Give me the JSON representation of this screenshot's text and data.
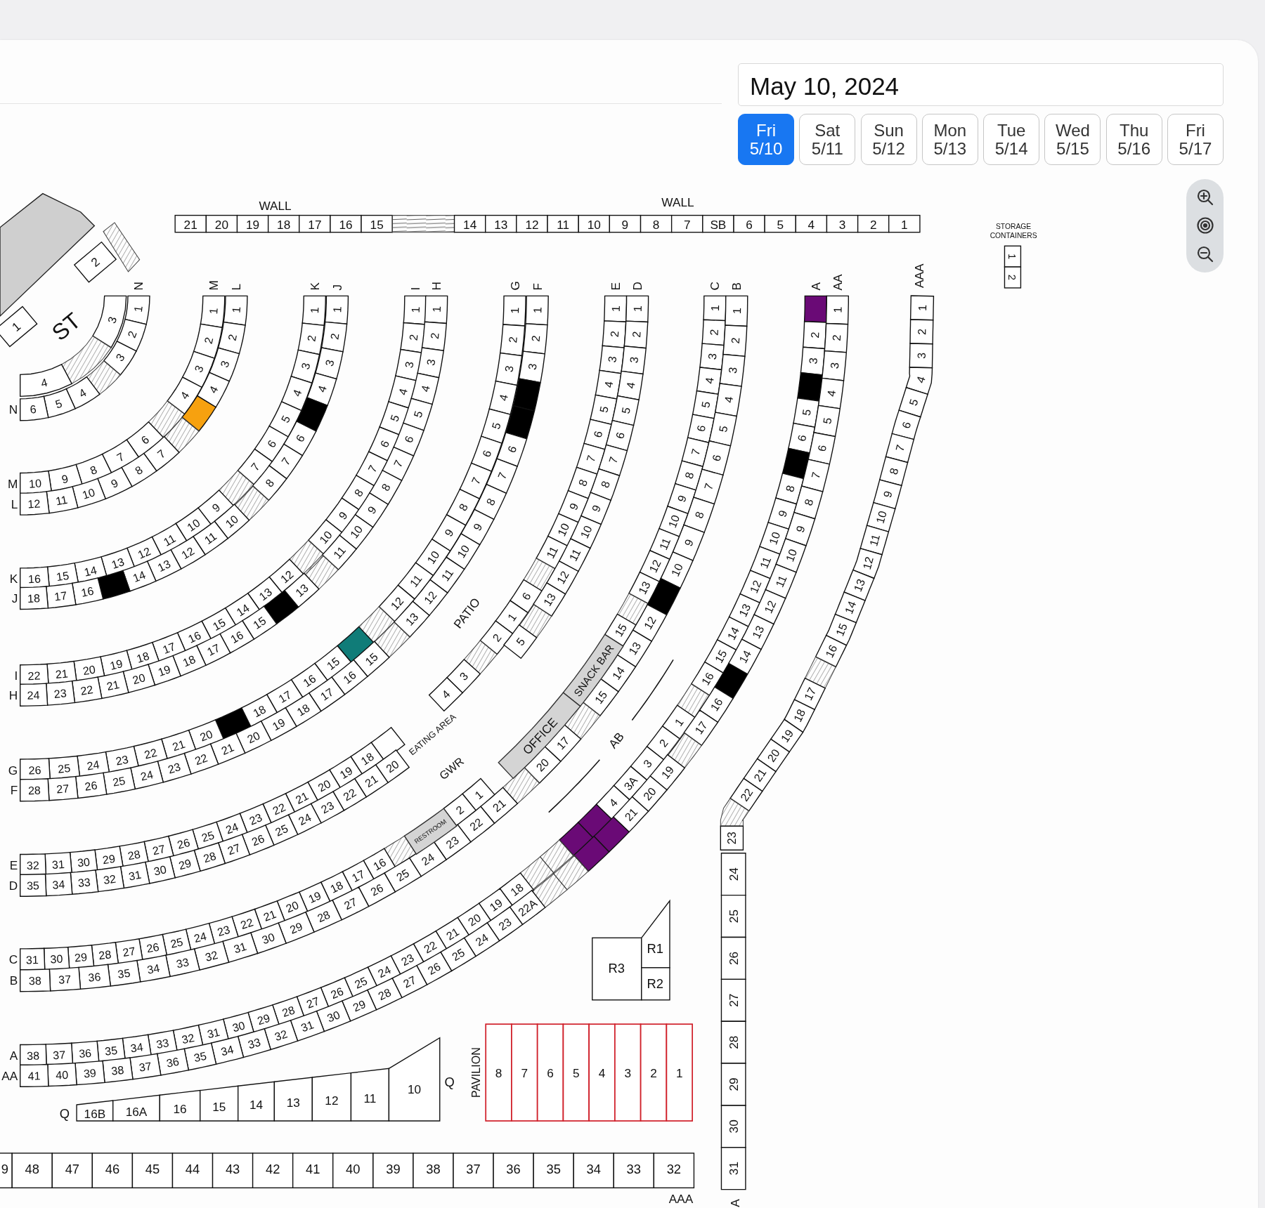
{
  "date_field": {
    "value": "May 10, 2024"
  },
  "day_tabs": [
    {
      "day": "Fri",
      "date": "5/10",
      "selected": true
    },
    {
      "day": "Sat",
      "date": "5/11",
      "selected": false
    },
    {
      "day": "Sun",
      "date": "5/12",
      "selected": false
    },
    {
      "day": "Mon",
      "date": "5/13",
      "selected": false
    },
    {
      "day": "Tue",
      "date": "5/14",
      "selected": false
    },
    {
      "day": "Wed",
      "date": "5/15",
      "selected": false
    },
    {
      "day": "Thu",
      "date": "5/16",
      "selected": false
    },
    {
      "day": "Fri",
      "date": "5/17",
      "selected": false
    }
  ],
  "map": {
    "wall": {
      "labels": [
        "WALL",
        "WALL"
      ],
      "seats": [
        "21",
        "20",
        "19",
        "18",
        "17",
        "16",
        "15",
        {
          "kind": "aisle"
        },
        "14",
        "13",
        "12",
        "11",
        "10",
        "9",
        "8",
        "7",
        "SB",
        "6",
        "5",
        "4",
        "3",
        "2",
        "1"
      ]
    },
    "stage": {
      "label": "ST",
      "boxes": [
        "1",
        "2"
      ]
    },
    "storage": {
      "label_lines": [
        "STORAGE",
        "CONTAINERS"
      ],
      "boxes": [
        "1",
        "2"
      ]
    },
    "rings": [
      {
        "rows": [
          {
            "seats": [
              "3",
              {
                "kind": "aisle"
              },
              "4"
            ]
          },
          {
            "top_label": "N",
            "side_label": "N",
            "seats": [
              "1",
              "2",
              "3",
              {
                "kind": "aisle"
              },
              "4",
              "5",
              "6"
            ]
          }
        ]
      },
      {
        "rows": [
          {
            "top_label": "M",
            "side_label": "M",
            "seats": [
              "1",
              "2",
              "3",
              "4",
              {
                "kind": "aisle"
              },
              "6",
              "7",
              "8",
              "9",
              "10"
            ]
          },
          {
            "top_label": "L",
            "side_label": "L",
            "seats": [
              "1",
              "2",
              "3",
              "4",
              {
                "kind": "filled",
                "color": "#f7a10f"
              },
              {
                "kind": "aisle"
              },
              "7",
              "8",
              "9",
              "10",
              "11",
              "12"
            ]
          }
        ]
      },
      {
        "rows": [
          {
            "top_label": "K",
            "side_label": "K",
            "seats": [
              "1",
              "2",
              "3",
              "4",
              "5",
              "6",
              "7",
              {
                "kind": "aisle"
              },
              "9",
              "10",
              "11",
              "12",
              "13",
              "14",
              "15",
              "16"
            ]
          },
          {
            "top_label": "J",
            "side_label": "J",
            "seats": [
              "1",
              "2",
              "3",
              "4",
              {
                "kind": "filled",
                "color": "#000000"
              },
              "6",
              "7",
              "8",
              {
                "kind": "aisle"
              },
              "10",
              "11",
              "12",
              "13",
              "14",
              {
                "kind": "filled",
                "color": "#000000"
              },
              "16",
              "17",
              "18"
            ]
          }
        ]
      },
      {
        "rows": [
          {
            "top_label": "I",
            "side_label": "I",
            "seats": [
              "1",
              "2",
              "3",
              "4",
              "5",
              "6",
              "7",
              "8",
              "9",
              "10",
              {
                "kind": "aisle"
              },
              "12",
              "13",
              "14",
              "15",
              "16",
              "17",
              "18",
              "19",
              "20",
              "21",
              "22"
            ]
          },
          {
            "top_label": "H",
            "side_label": "H",
            "seats": [
              "1",
              "2",
              "3",
              "4",
              "5",
              "6",
              "7",
              "8",
              "9",
              "10",
              "11",
              {
                "kind": "aisle"
              },
              "13",
              {
                "kind": "filled",
                "color": "#000000"
              },
              "15",
              "16",
              "17",
              "18",
              "19",
              "20",
              "21",
              "22",
              "23",
              "24"
            ]
          }
        ]
      },
      {
        "rows": [
          {
            "top_label": "G",
            "side_label": "G",
            "seats": [
              "1",
              "2",
              "3",
              "4",
              "5",
              "6",
              "7",
              "8",
              "9",
              "10",
              "11",
              "12",
              {
                "kind": "aisle"
              },
              {
                "kind": "filled",
                "color": "#107c78"
              },
              "15",
              "16",
              "17",
              "18",
              {
                "kind": "filled",
                "color": "#000000"
              },
              "20",
              "21",
              "22",
              "23",
              "24",
              "25",
              "26"
            ]
          },
          {
            "top_label": "F",
            "side_label": "F",
            "seats": [
              "1",
              "2",
              "3",
              {
                "kind": "filled",
                "color": "#000000"
              },
              {
                "kind": "filled",
                "color": "#000000"
              },
              "6",
              "7",
              "8",
              "9",
              "10",
              "11",
              "12",
              "13",
              {
                "kind": "aisle"
              },
              "15",
              "16",
              "17",
              "18",
              "19",
              "20",
              "21",
              "22",
              "23",
              "24",
              "25",
              "26",
              "27",
              "28"
            ]
          }
        ]
      },
      {
        "rows": [
          {
            "top_label": "E",
            "side_label": "E",
            "seats": [
              "1",
              "2",
              "3",
              "4",
              "5",
              "6",
              "7",
              "8",
              "9",
              "10",
              "11",
              {
                "kind": "aisle"
              },
              "6",
              "1",
              "2",
              {
                "kind": "aisle"
              },
              "3",
              "4",
              {
                "kind": "gap"
              },
              {
                "kind": "gap"
              },
              {
                "kind": "empty"
              },
              "18",
              "19",
              "20",
              "21",
              "22",
              "23",
              "24",
              "25",
              "26",
              "27",
              "28",
              "29",
              "30",
              "31",
              "32"
            ]
          },
          {
            "top_label": "D",
            "side_label": "D",
            "seats": [
              "1",
              "2",
              "3",
              "4",
              "5",
              "6",
              "7",
              "8",
              "9",
              "10",
              "11",
              "12",
              "13",
              {
                "kind": "aisle"
              },
              "5",
              {
                "kind": "gap"
              },
              {
                "kind": "gap"
              },
              {
                "kind": "gap"
              },
              {
                "kind": "gap"
              },
              {
                "kind": "gap"
              },
              {
                "kind": "gap"
              },
              "20",
              "21",
              "22",
              "23",
              "24",
              "25",
              "26",
              "27",
              "28",
              "29",
              "30",
              "31",
              "32",
              "33",
              "34",
              "35"
            ]
          }
        ]
      },
      {
        "rows": [
          {
            "top_label": "C",
            "side_label": "C",
            "seats": [
              "1",
              "2",
              "3",
              "4",
              "5",
              "6",
              "7",
              "8",
              "9",
              "10",
              "11",
              "12",
              "13",
              {
                "kind": "aisle"
              },
              "15",
              {
                "kind": "gap"
              },
              {
                "kind": "gap"
              },
              {
                "kind": "gap"
              },
              {
                "kind": "gap"
              },
              {
                "kind": "gap"
              },
              {
                "kind": "gap"
              },
              {
                "kind": "gap"
              },
              {
                "kind": "gap"
              },
              "1",
              "2",
              {
                "kind": "gap"
              },
              {
                "kind": "gap"
              },
              {
                "kind": "aisle"
              },
              "16",
              "17",
              "18",
              "19",
              "20",
              "21",
              "22",
              "23",
              "24",
              "25",
              "26",
              "27",
              "28",
              "29",
              "30",
              "31"
            ]
          },
          {
            "top_label": "B",
            "side_label": "B",
            "seats": [
              "1",
              "2",
              "3",
              "4",
              "5",
              "6",
              "7",
              "8",
              "9",
              "10",
              {
                "kind": "filled",
                "color": "#000000"
              },
              "12",
              "13",
              "14",
              "15",
              {
                "kind": "aisle"
              },
              "17",
              "20",
              {
                "kind": "aisle"
              },
              "21",
              "22",
              "23",
              "24",
              "25",
              "26",
              "27",
              "28",
              "29",
              "30",
              "31",
              "32",
              "33",
              "34",
              "35",
              "36",
              "37",
              "38"
            ]
          }
        ]
      },
      {
        "rows": [
          {
            "top_label": "A",
            "side_label": "A",
            "seats": [
              {
                "kind": "filled",
                "color": "#6a0a76"
              },
              "2",
              "3",
              {
                "kind": "filled",
                "color": "#000000"
              },
              "5",
              "6",
              {
                "kind": "filled",
                "color": "#000000"
              },
              "8",
              "9",
              "10",
              "11",
              "12",
              "13",
              "14",
              "15",
              "16",
              {
                "kind": "aisle"
              },
              "1",
              "2",
              "3",
              "3A",
              "4",
              {
                "kind": "filled",
                "color": "#6a0a76"
              },
              {
                "kind": "filled",
                "color": "#6a0a76"
              },
              {
                "kind": "aisle"
              },
              {
                "kind": "aisle"
              },
              "18",
              "19",
              "20",
              "21",
              "22",
              "23",
              "24",
              "25",
              "26",
              "27",
              "28",
              "29",
              "30",
              "31",
              "32",
              "33",
              "34",
              "35",
              "36",
              "37",
              "38"
            ]
          },
          {
            "top_label": "AA",
            "side_label": "AA",
            "seats": [
              "1",
              "2",
              "3",
              "4",
              "5",
              "6",
              "7",
              "8",
              "9",
              "10",
              "11",
              "12",
              "13",
              "14",
              {
                "kind": "filled",
                "color": "#000000"
              },
              "16",
              "17",
              {
                "kind": "aisle"
              },
              "19",
              "20",
              "21",
              {
                "kind": "filled",
                "color": "#6a0a76"
              },
              {
                "kind": "filled",
                "color": "#6a0a76"
              },
              {
                "kind": "aisle"
              },
              {
                "kind": "aisle"
              },
              "22A",
              "23",
              "24",
              "25",
              "26",
              "27",
              "28",
              "29",
              "30",
              "31",
              "32",
              "33",
              "34",
              "35",
              "36",
              "37",
              "38",
              "39",
              "40",
              "41"
            ]
          }
        ]
      }
    ],
    "areas": [
      {
        "kind": "label",
        "text": "PATIO"
      },
      {
        "kind": "label",
        "text": "EATING AREA"
      },
      {
        "kind": "building",
        "text": "SNACK BAR"
      },
      {
        "kind": "building",
        "text": "OFFICE"
      },
      {
        "kind": "label",
        "text": "GWR"
      },
      {
        "kind": "building",
        "text": "RESTROOM"
      },
      {
        "kind": "label",
        "text": "AB"
      }
    ],
    "aaa": {
      "label": "AAA",
      "upper_seats": [
        "1",
        "2",
        "3",
        "4",
        "5",
        "6",
        "7",
        "8",
        "9",
        "10",
        "11",
        "12",
        "13",
        "14",
        "15",
        "16",
        {
          "kind": "aisle"
        },
        "17",
        "18",
        "19",
        "20",
        "21",
        "22",
        {
          "kind": "aisle"
        },
        "23"
      ],
      "column_seats": [
        "24",
        "25",
        "26",
        "27",
        "28",
        "29",
        "30",
        "31"
      ],
      "column_label": "A"
    },
    "bottom_row": {
      "label": "AAA",
      "seats": [
        "9",
        "48",
        "47",
        "46",
        "45",
        "44",
        "43",
        "42",
        "41",
        "40",
        "39",
        "38",
        "37",
        "36",
        "35",
        "34",
        "33",
        "32"
      ]
    },
    "q_row": {
      "labels": [
        "Q",
        "Q"
      ],
      "seats": [
        "16B",
        "16A",
        "16",
        "15",
        "14",
        "13",
        "12",
        "11",
        "10"
      ]
    },
    "rooms": [
      "R3",
      "R1",
      "R2"
    ],
    "pavilion": {
      "label": "PAVILION",
      "stalls": [
        "8",
        "7",
        "6",
        "5",
        "4",
        "3",
        "2",
        "1"
      ]
    }
  }
}
